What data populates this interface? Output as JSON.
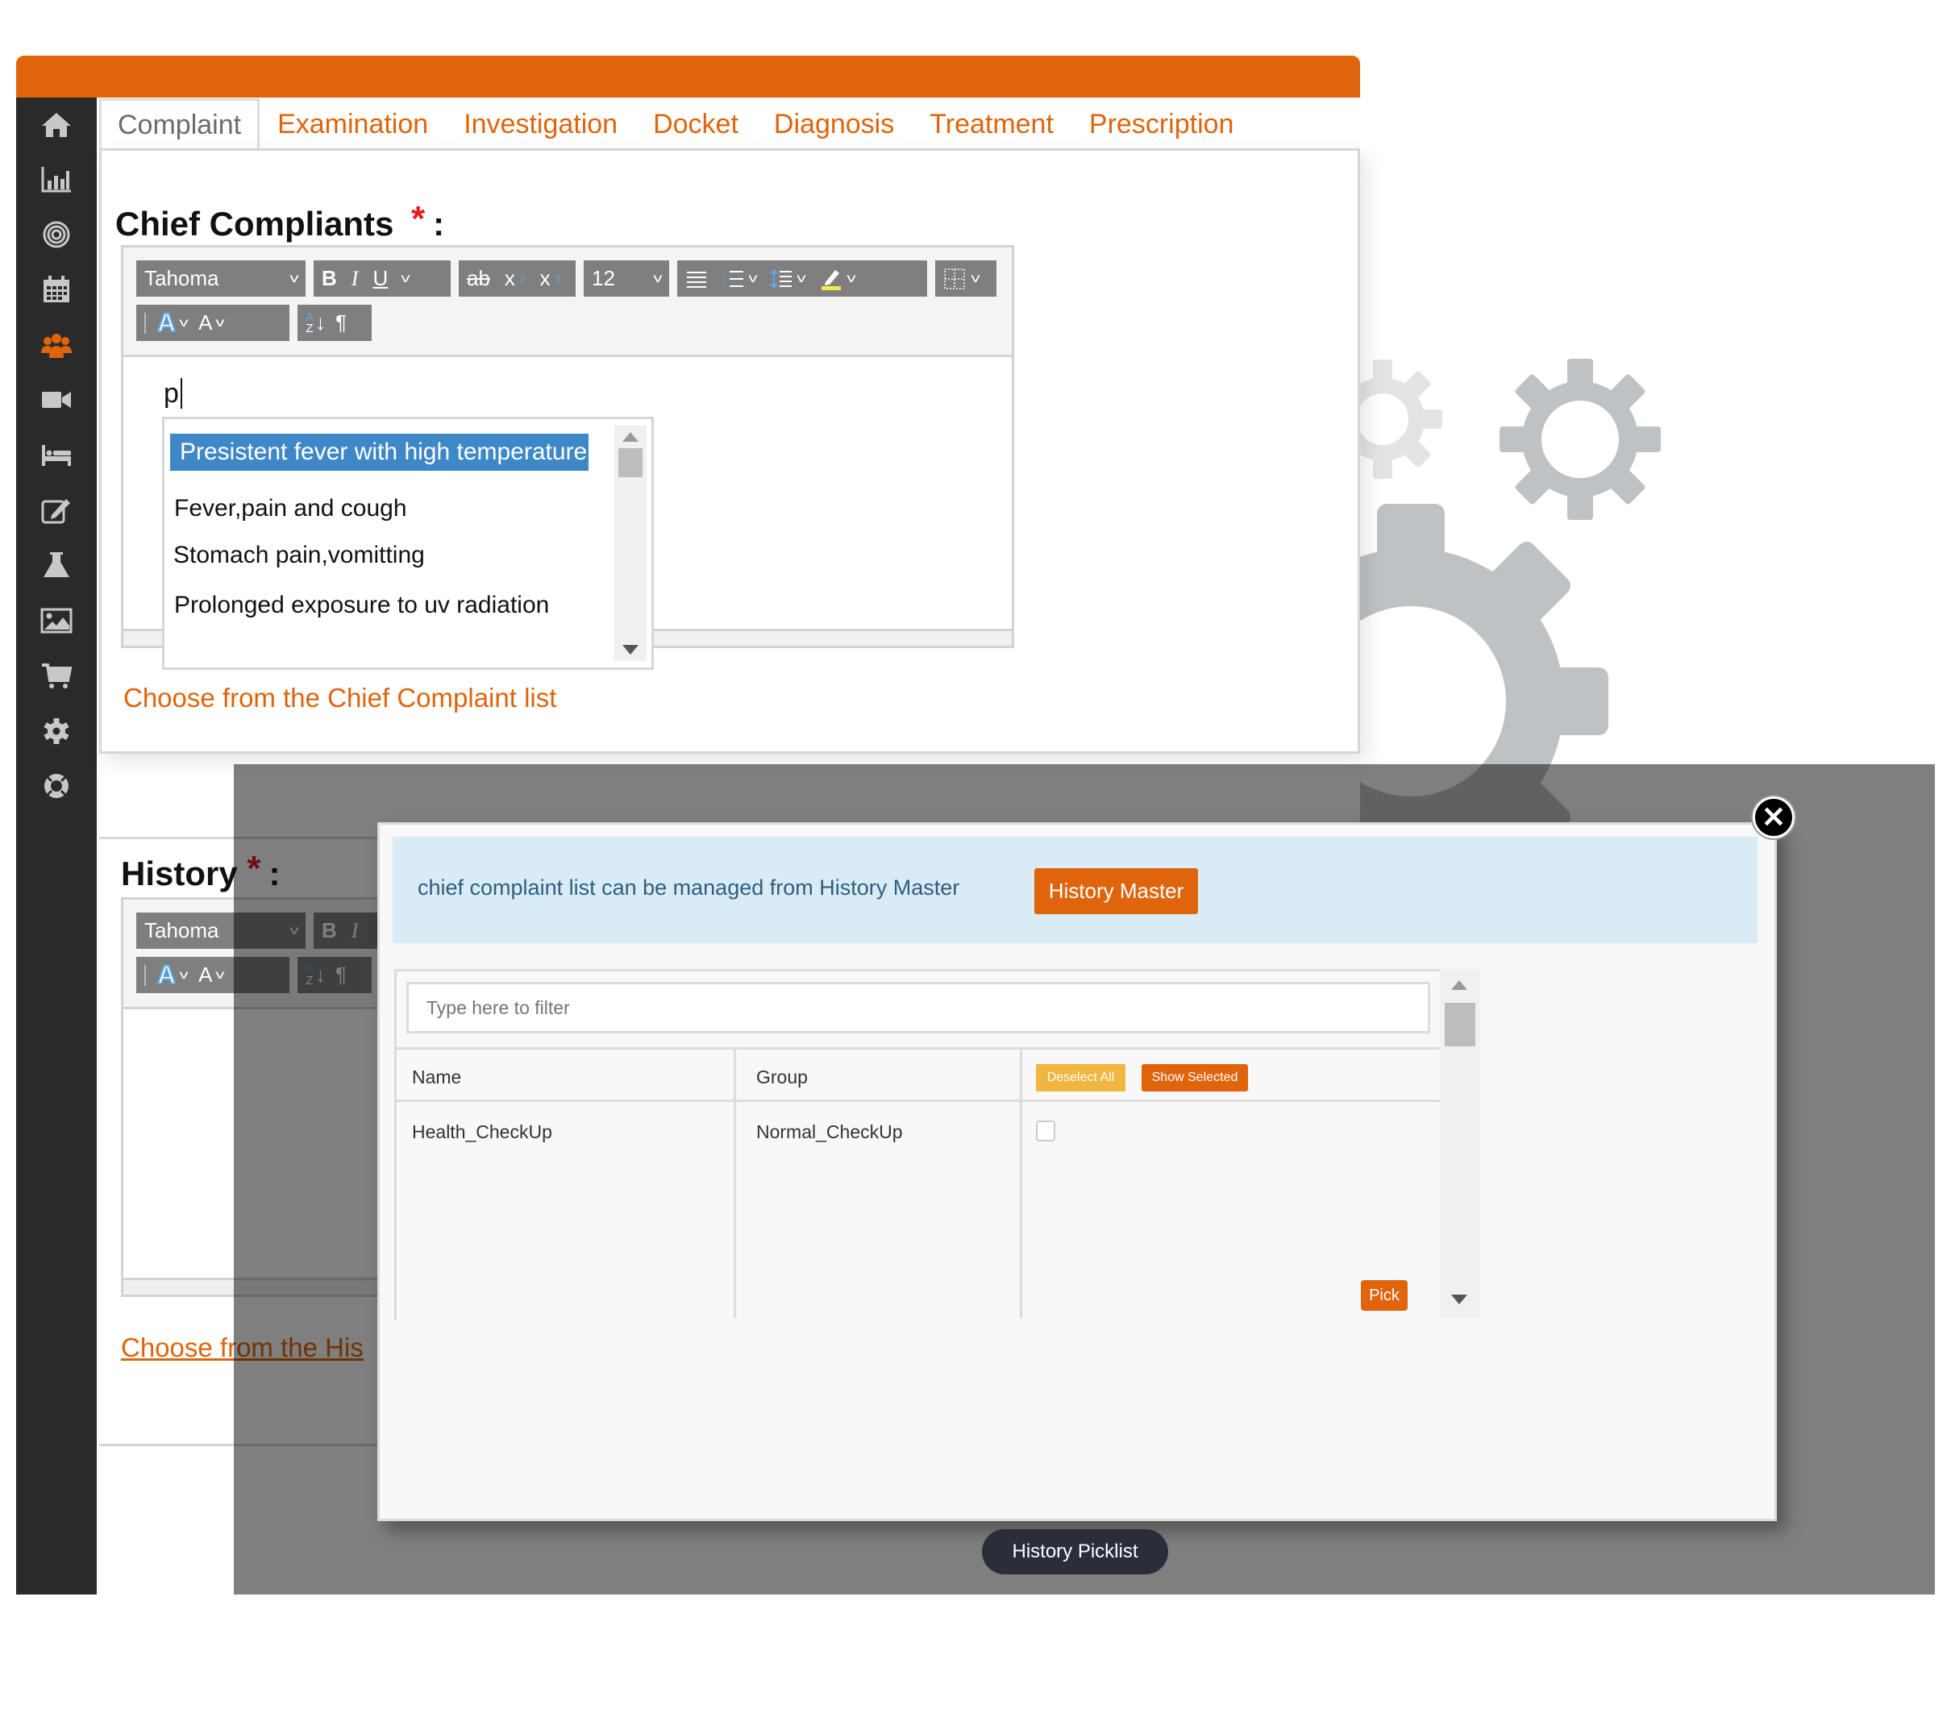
{
  "app": {
    "brand_color": "#e0640b"
  },
  "sidebar": {
    "items": [
      {
        "icon": "home-icon",
        "active": false
      },
      {
        "icon": "bar-chart-icon",
        "active": false
      },
      {
        "icon": "target-icon",
        "active": false
      },
      {
        "icon": "calendar-icon",
        "active": false
      },
      {
        "icon": "users-icon",
        "active": true
      },
      {
        "icon": "video-camera-icon",
        "active": false
      },
      {
        "icon": "bed-icon",
        "active": false
      },
      {
        "icon": "edit-icon",
        "active": false
      },
      {
        "icon": "flask-icon",
        "active": false
      },
      {
        "icon": "image-icon",
        "active": false
      },
      {
        "icon": "cart-icon",
        "active": false
      },
      {
        "icon": "gear-icon",
        "active": false
      },
      {
        "icon": "lifebuoy-icon",
        "active": false
      }
    ]
  },
  "tabs": [
    {
      "label": "Complaint",
      "active": true
    },
    {
      "label": "Examination",
      "active": false
    },
    {
      "label": "Investigation",
      "active": false
    },
    {
      "label": "Docket",
      "active": false
    },
    {
      "label": "Diagnosis",
      "active": false
    },
    {
      "label": "Treatment",
      "active": false
    },
    {
      "label": "Prescription",
      "active": false
    }
  ],
  "chief": {
    "heading": "Chief Compliants",
    "required_mark": "*",
    "colon": ":",
    "editor": {
      "font_family": "Tahoma",
      "font_size": "12",
      "content": "p",
      "toolbar": {
        "bold": "B",
        "italic": "I",
        "underline": "U",
        "strike": "ab",
        "subscript": "x",
        "superscript": "x",
        "script_num": "2",
        "font_color": "A",
        "bg_color": "A",
        "sort_a": "A",
        "sort_z": "Z",
        "sort_arrow": "↓",
        "pilcrow": "¶",
        "chev": "v"
      }
    },
    "suggestions": [
      {
        "text": "Presistent fever with high temperature",
        "selected": true
      },
      {
        "text": "Fever,pain and cough",
        "selected": false
      },
      {
        "text": "Stomach pain,vomitting",
        "selected": false
      },
      {
        "text": "Prolonged exposure to uv radiation",
        "selected": false
      }
    ],
    "choose_link": "Choose from the Chief Complaint list"
  },
  "history": {
    "heading": "History",
    "required_mark": "*",
    "colon": ":",
    "editor": {
      "font_family": "Tahoma"
    },
    "choose_link": "Choose from the His"
  },
  "modal": {
    "info_text": "chief complaint list can be managed from History Master",
    "history_master_button": "History Master",
    "filter_placeholder": "Type here to filter",
    "columns": [
      "Name",
      "Group"
    ],
    "deselect_all": "Deselect All",
    "show_selected": "Show Selected",
    "rows": [
      {
        "name": "Health_CheckUp",
        "group": "Normal_CheckUp",
        "checked": false
      }
    ],
    "pick_button": "Pick",
    "close_label": "✕"
  },
  "tooltip": {
    "text": "History Picklist"
  }
}
